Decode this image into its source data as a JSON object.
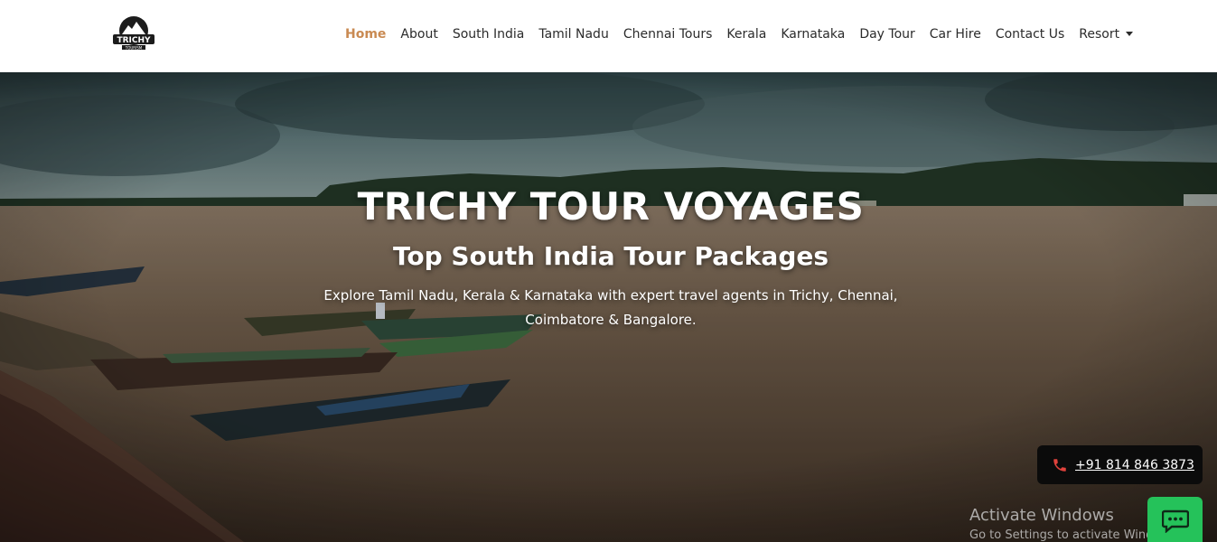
{
  "brand": {
    "logo_text": "TRICHY",
    "logo_subtext": "TOURISM"
  },
  "nav": {
    "items": [
      {
        "label": "Home",
        "active": true
      },
      {
        "label": "About"
      },
      {
        "label": "South India"
      },
      {
        "label": "Tamil Nadu"
      },
      {
        "label": "Chennai Tours"
      },
      {
        "label": "Kerala"
      },
      {
        "label": "Karnataka"
      },
      {
        "label": "Day Tour"
      },
      {
        "label": "Car Hire"
      },
      {
        "label": "Contact Us"
      },
      {
        "label": "Resort",
        "dropdown": true
      }
    ]
  },
  "hero": {
    "title": "TRICHY TOUR VOYAGES",
    "subtitle": "Top South India Tour Packages",
    "description": "Explore Tamil Nadu, Kerala & Karnataka with expert travel agents in Trichy, Chennai, Coimbatore & Bangalore."
  },
  "contact": {
    "phone": "+91 814 846 3873",
    "phone_icon": "phone-icon",
    "chat_icon": "chat-icon"
  },
  "watermark": {
    "title": "Activate Windows",
    "subtitle": "Go to Settings to activate Windows."
  },
  "colors": {
    "nav_active": "#c98a52",
    "chat_button": "#25c25a",
    "phone_button": "#0b0b0b"
  }
}
